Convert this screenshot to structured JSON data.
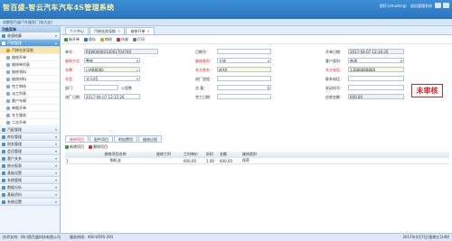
{
  "header": {
    "app_title": "智百盛-智云汽车汽车4S管理系统",
    "user": "您好:(chunting)",
    "switch_label": "退出管理系统",
    "shop_name": "成都智百盛汽车服务厂(机大店)"
  },
  "sidebar": {
    "title": "功能菜单",
    "groups": [
      {
        "label": "收银结算"
      },
      {
        "label": "汽修管理",
        "active": true
      }
    ],
    "sub_items": [
      {
        "label": "汽修业务导航",
        "active": true
      },
      {
        "label": "维修开单"
      },
      {
        "label": "维修单列表"
      },
      {
        "label": "维修领料"
      },
      {
        "label": "维修材料"
      },
      {
        "label": "完工审核"
      },
      {
        "label": "派工列表"
      },
      {
        "label": "客户车辆"
      },
      {
        "label": "单据开单"
      },
      {
        "label": "车主服务"
      },
      {
        "label": "二次开单"
      }
    ],
    "more_groups": [
      {
        "label": "汽配管理"
      },
      {
        "label": "库存管理"
      },
      {
        "label": "财务管理"
      },
      {
        "label": "会员管理"
      },
      {
        "label": "客户关系"
      },
      {
        "label": "统计报表"
      },
      {
        "label": "基础设置"
      },
      {
        "label": "系统管理"
      },
      {
        "label": "数据分析"
      },
      {
        "label": "基础资料"
      },
      {
        "label": "系统设置"
      }
    ]
  },
  "tabs": [
    {
      "label": "个人中心",
      "active": false
    },
    {
      "label": "汽修业务导航",
      "active": false
    },
    {
      "label": "维修开单",
      "active": true
    }
  ],
  "toolbar": {
    "new": "新开单",
    "save": "保存",
    "audit": "审核",
    "void": "作废",
    "print": "打印"
  },
  "form": {
    "order_no_label": "单号：",
    "order_no": "RSW0000010001704700",
    "date_label": "日期号：",
    "date_value": "",
    "open_date_label": "开单日期：",
    "open_date": "2017-04-07 12:16:26",
    "repair_type_label": "维修方式：",
    "repair_type": "整修",
    "repair_class_label": "维修类别：",
    "repair_class": "大修",
    "customer_type_label": "客户类别：",
    "customer_type": "普通",
    "plate_label": "车牌：",
    "plate": "川AB8080",
    "owner_label": "车主姓名：",
    "owner": "赵XX",
    "phone_label": "车主电话：",
    "phone": "13888888888",
    "model_label": "车型：",
    "model": "宝马X5",
    "mileage_label": "进厂里程：",
    "mileage": "",
    "contact_label": "联系电话：",
    "contact": "",
    "dept_label": "部门：",
    "dept": "",
    "unit": "公里数",
    "qty_label": "次 量：",
    "qty": "0",
    "vin_label": "发动机号：",
    "vin": "",
    "arrive_label": "进厂日期：",
    "arrive": "2017-04-07 12:15:26",
    "finish_label": "完工日期：",
    "finish": "",
    "total_label": "应收金额：",
    "total": "600.00",
    "stamp": "未审核"
  },
  "detail_tabs": [
    {
      "label": "维修项目",
      "active": true
    },
    {
      "label": "配件项目",
      "active": false
    },
    {
      "label": "附加费用",
      "active": false
    },
    {
      "label": "维修过程",
      "active": false
    }
  ],
  "detail_tools": {
    "add": "新增项目",
    "delete": "删除项目"
  },
  "grid": {
    "headers": [
      "",
      "维修项目名称",
      "维修工时",
      "工时单价",
      "折扣",
      "金额",
      "维修类别"
    ],
    "rows": [
      [
        "1",
        "钢机油",
        "",
        "600.00",
        "1.00",
        "600.00",
        "保养"
      ]
    ]
  },
  "status": {
    "company": "技术支持：四川智百盛科技有限公司",
    "hotline": "服务热线：400-8595-291",
    "datetime": "2017年4月7日[星期五]14时"
  },
  "colors": {
    "header_bg": "#2a73bd",
    "title_text": "#fff3a0",
    "stamp": "#dd2222",
    "required_label": "#dd2222"
  }
}
